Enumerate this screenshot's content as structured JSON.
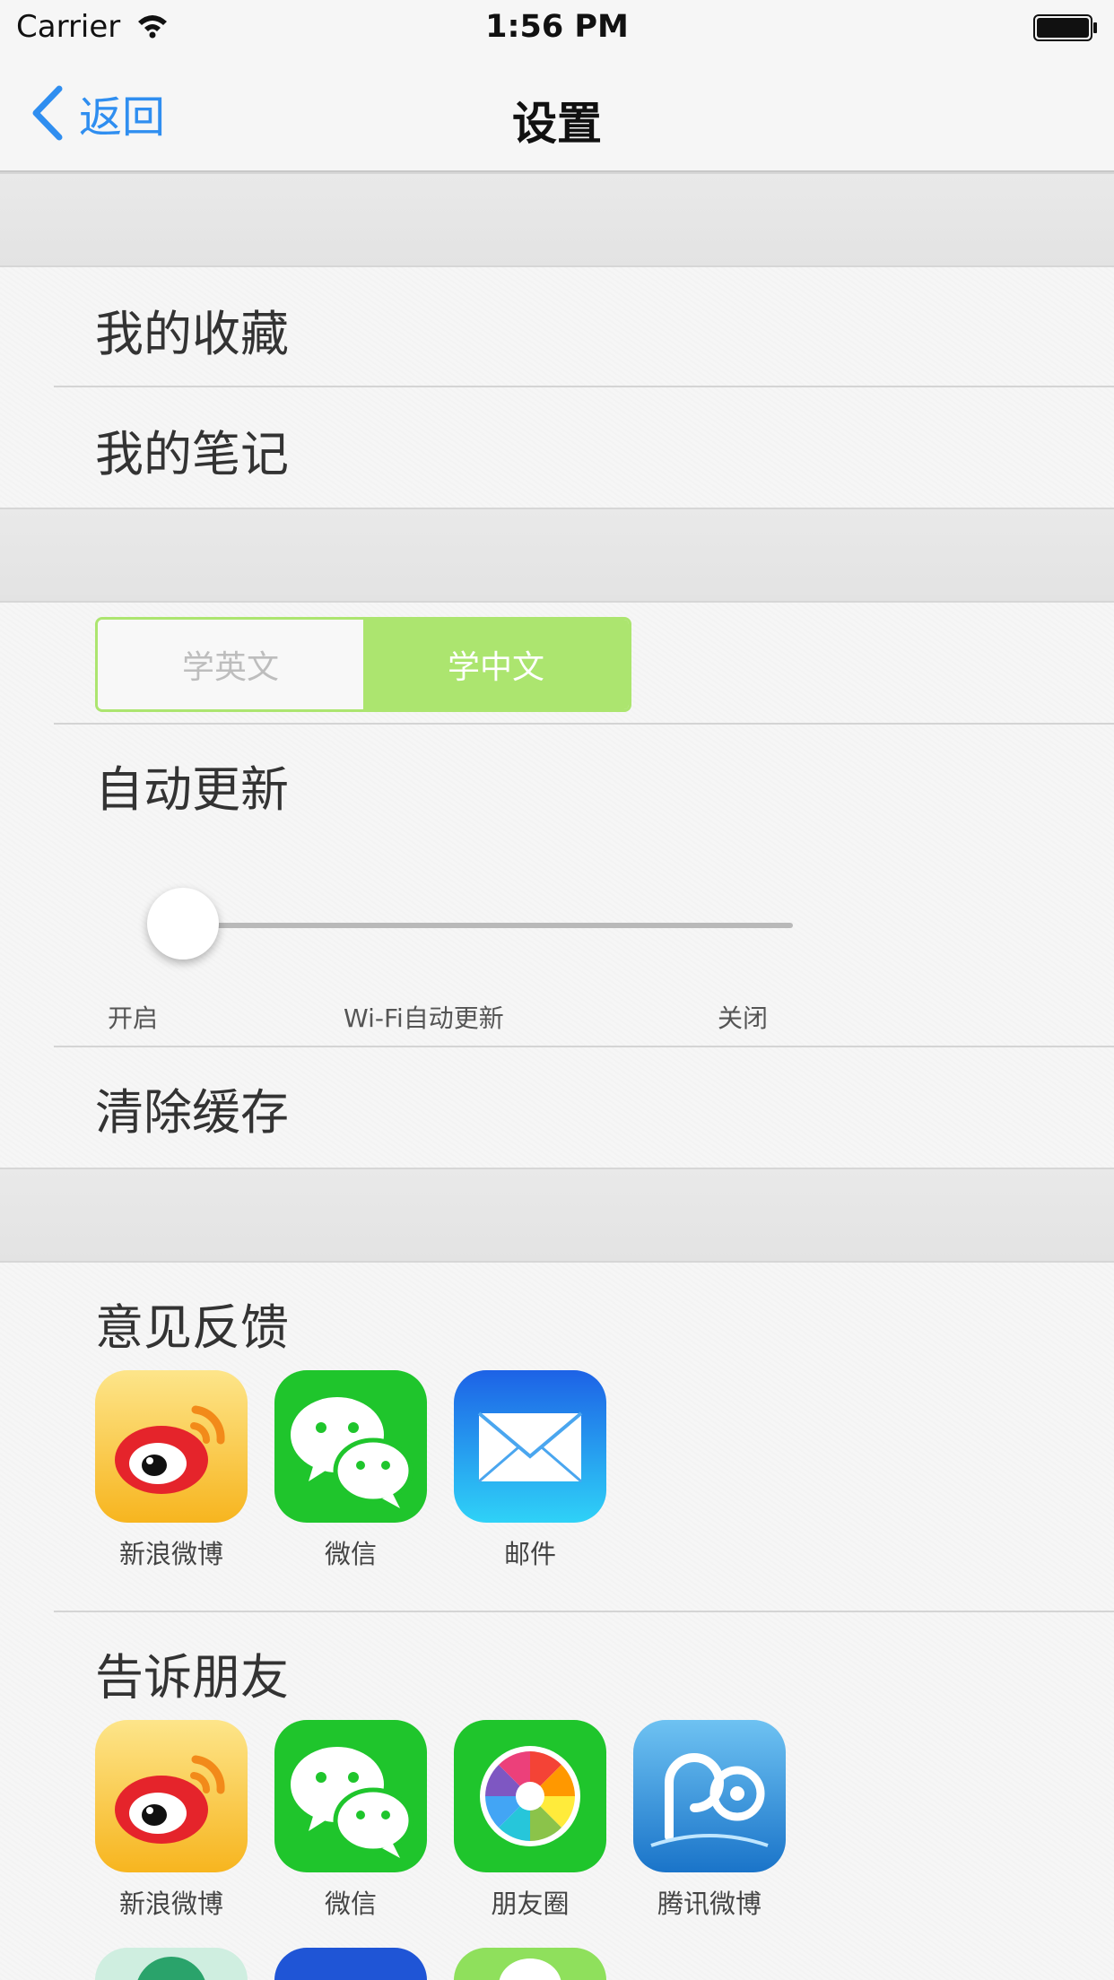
{
  "status_bar": {
    "carrier": "Carrier",
    "time": "1:56 PM"
  },
  "nav": {
    "back_label": "返回",
    "title": "设置"
  },
  "menu": {
    "favorites": "我的收藏",
    "notes": "我的笔记",
    "auto_update": "自动更新",
    "clear_cache": "清除缓存"
  },
  "language_segment": {
    "options": [
      "学英文",
      "学中文"
    ],
    "selected": "学中文"
  },
  "auto_update_slider": {
    "labels": [
      "开启",
      "Wi-Fi自动更新",
      "关闭"
    ],
    "selected_index": 0
  },
  "feedback": {
    "title": "意见反馈",
    "apps": [
      {
        "label": "新浪微博",
        "icon": "weibo-icon"
      },
      {
        "label": "微信",
        "icon": "wechat-icon"
      },
      {
        "label": "邮件",
        "icon": "mail-icon"
      }
    ]
  },
  "tell_friends": {
    "title": "告诉朋友",
    "apps": [
      {
        "label": "新浪微博",
        "icon": "weibo-icon"
      },
      {
        "label": "微信",
        "icon": "wechat-icon"
      },
      {
        "label": "朋友圈",
        "icon": "moments-icon"
      },
      {
        "label": "腾讯微博",
        "icon": "tencent-weibo-icon"
      }
    ]
  },
  "colors": {
    "accent_blue": "#2f8ef0",
    "segment_green": "#ace56f",
    "wechat_green": "#21c52c",
    "mail_blue": "#1f8bf5",
    "weibo_yellow": "#f9c024"
  }
}
